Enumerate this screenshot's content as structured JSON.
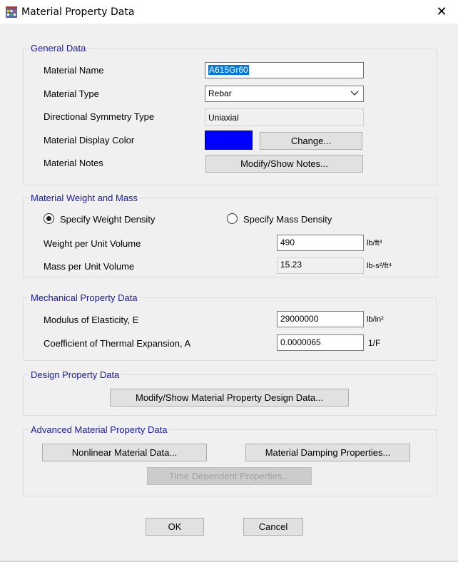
{
  "window": {
    "title": "Material Property Data",
    "close_glyph": "✕",
    "icons": {
      "app": "building-app-icon",
      "close": "close-icon"
    }
  },
  "general": {
    "title": "General Data",
    "material_name_label": "Material Name",
    "material_name_value": "A615Gr60",
    "material_type_label": "Material Type",
    "material_type_value": "Rebar",
    "symmetry_label": "Directional Symmetry Type",
    "symmetry_value": "Uniaxial",
    "display_color_label": "Material Display Color",
    "display_color": "#0000ff",
    "change_button": "Change...",
    "notes_label": "Material Notes",
    "notes_button": "Modify/Show Notes..."
  },
  "weight_mass": {
    "title": "Material Weight and Mass",
    "radio_weight": "Specify Weight Density",
    "radio_mass": "Specify Mass Density",
    "selected": "weight",
    "weight_label": "Weight per Unit Volume",
    "weight_value": "490",
    "weight_unit": "lb/ft³",
    "mass_label": "Mass per Unit Volume",
    "mass_value": "15.23",
    "mass_unit": "lb-s²/ft⁴"
  },
  "mechanical": {
    "title": "Mechanical Property Data",
    "modulus_label": "Modulus of Elasticity,  E",
    "modulus_value": "29000000",
    "modulus_unit": "lb/in²",
    "thermal_label": "Coefficient of Thermal Expansion,  A",
    "thermal_value": "0.0000065",
    "thermal_unit": "1/F"
  },
  "design": {
    "title": "Design Property Data",
    "button": "Modify/Show Material Property Design Data..."
  },
  "advanced": {
    "title": "Advanced Material Property Data",
    "nonlinear_button": "Nonlinear Material Data...",
    "damping_button": "Material Damping Properties...",
    "time_button": "Time Dependent Properties..."
  },
  "footer": {
    "ok": "OK",
    "cancel": "Cancel"
  },
  "colors": {
    "group_title": "#1a1aa0",
    "selection": "#0078d7",
    "accent_focus": "#2b7bd6"
  }
}
